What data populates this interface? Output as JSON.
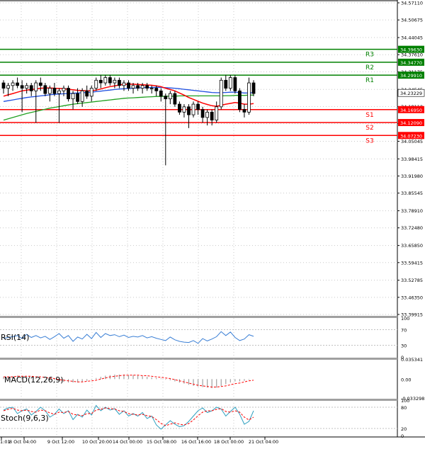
{
  "chart_data": {
    "type": "candlestick",
    "price_axis_labels": [
      "34.57110",
      "34.50675",
      "34.44045",
      "34.37610",
      "34.31175",
      "34.24545",
      "34.18110",
      "34.11675",
      "34.05045",
      "33.98415",
      "33.91980",
      "33.85545",
      "33.78910",
      "33.72480",
      "33.65850",
      "33.59415",
      "33.52785",
      "33.46350",
      "33.39915"
    ],
    "ylim": [
      33.39915,
      34.5711
    ],
    "x_labels": [
      "1:01",
      "8 Oct 04:00",
      "9 Oct 12:00",
      "10 Oct 20:00",
      "14 Oct 00:00",
      "15 Oct 08:00",
      "16 Oct 16:00",
      "18 Oct 00:00",
      "21 Oct 04:00"
    ],
    "current_price": {
      "value": 34.23229,
      "label": "34.23229"
    },
    "levels": [
      {
        "name": "R3",
        "value": 34.3963,
        "label": "34.39630",
        "color": "#008000"
      },
      {
        "name": "R2",
        "value": 34.3477,
        "label": "34.34770",
        "color": "#008000"
      },
      {
        "name": "R1",
        "value": 34.2991,
        "label": "34.29910",
        "color": "#008000"
      },
      {
        "name": "S1",
        "value": 34.1695,
        "label": "34.16950",
        "color": "#ff0000"
      },
      {
        "name": "S2",
        "value": 34.1209,
        "label": "34.12090",
        "color": "#ff0000"
      },
      {
        "name": "S3",
        "value": 34.0723,
        "label": "34.07230",
        "color": "#ff0000"
      }
    ],
    "candles": [
      {
        "o": 34.27,
        "h": 34.28,
        "l": 34.23,
        "c": 34.25
      },
      {
        "o": 34.25,
        "h": 34.27,
        "l": 34.22,
        "c": 34.26
      },
      {
        "o": 34.26,
        "h": 34.28,
        "l": 34.24,
        "c": 34.27
      },
      {
        "o": 34.27,
        "h": 34.29,
        "l": 34.25,
        "c": 34.26
      },
      {
        "o": 34.26,
        "h": 34.28,
        "l": 34.16,
        "c": 34.25
      },
      {
        "o": 34.25,
        "h": 34.27,
        "l": 34.23,
        "c": 34.26
      },
      {
        "o": 34.26,
        "h": 34.27,
        "l": 34.22,
        "c": 34.24
      },
      {
        "o": 34.24,
        "h": 34.28,
        "l": 34.12,
        "c": 34.27
      },
      {
        "o": 34.27,
        "h": 34.29,
        "l": 34.24,
        "c": 34.26
      },
      {
        "o": 34.26,
        "h": 34.27,
        "l": 34.22,
        "c": 34.23
      },
      {
        "o": 34.23,
        "h": 34.26,
        "l": 34.2,
        "c": 34.25
      },
      {
        "o": 34.25,
        "h": 34.27,
        "l": 34.22,
        "c": 34.23
      },
      {
        "o": 34.23,
        "h": 34.25,
        "l": 34.12,
        "c": 34.24
      },
      {
        "o": 34.24,
        "h": 34.26,
        "l": 34.22,
        "c": 34.25
      },
      {
        "o": 34.25,
        "h": 34.26,
        "l": 34.2,
        "c": 34.21
      },
      {
        "o": 34.21,
        "h": 34.24,
        "l": 34.17,
        "c": 34.23
      },
      {
        "o": 34.23,
        "h": 34.25,
        "l": 34.19,
        "c": 34.2
      },
      {
        "o": 34.2,
        "h": 34.25,
        "l": 34.18,
        "c": 34.24
      },
      {
        "o": 34.24,
        "h": 34.26,
        "l": 34.21,
        "c": 34.22
      },
      {
        "o": 34.22,
        "h": 34.26,
        "l": 34.2,
        "c": 34.25
      },
      {
        "o": 34.25,
        "h": 34.29,
        "l": 34.24,
        "c": 34.28
      },
      {
        "o": 34.28,
        "h": 34.3,
        "l": 34.25,
        "c": 34.27
      },
      {
        "o": 34.27,
        "h": 34.3,
        "l": 34.26,
        "c": 34.29
      },
      {
        "o": 34.29,
        "h": 34.3,
        "l": 34.26,
        "c": 34.27
      },
      {
        "o": 34.27,
        "h": 34.29,
        "l": 34.25,
        "c": 34.28
      },
      {
        "o": 34.28,
        "h": 34.29,
        "l": 34.25,
        "c": 34.26
      },
      {
        "o": 34.26,
        "h": 34.28,
        "l": 34.24,
        "c": 34.27
      },
      {
        "o": 34.27,
        "h": 34.28,
        "l": 34.24,
        "c": 34.25
      },
      {
        "o": 34.25,
        "h": 34.27,
        "l": 34.23,
        "c": 34.26
      },
      {
        "o": 34.26,
        "h": 34.27,
        "l": 34.24,
        "c": 34.25
      },
      {
        "o": 34.25,
        "h": 34.27,
        "l": 34.23,
        "c": 34.26
      },
      {
        "o": 34.26,
        "h": 34.27,
        "l": 34.24,
        "c": 34.25
      },
      {
        "o": 34.25,
        "h": 34.26,
        "l": 34.23,
        "c": 34.25
      },
      {
        "o": 34.25,
        "h": 34.26,
        "l": 34.22,
        "c": 34.24
      },
      {
        "o": 34.24,
        "h": 34.25,
        "l": 34.2,
        "c": 34.22
      },
      {
        "o": 34.22,
        "h": 34.23,
        "l": 33.96,
        "c": 34.21
      },
      {
        "o": 34.21,
        "h": 34.24,
        "l": 34.19,
        "c": 34.23
      },
      {
        "o": 34.23,
        "h": 34.24,
        "l": 34.18,
        "c": 34.19
      },
      {
        "o": 34.19,
        "h": 34.2,
        "l": 34.15,
        "c": 34.16
      },
      {
        "o": 34.16,
        "h": 34.19,
        "l": 34.14,
        "c": 34.18
      },
      {
        "o": 34.18,
        "h": 34.19,
        "l": 34.1,
        "c": 34.15
      },
      {
        "o": 34.15,
        "h": 34.2,
        "l": 34.14,
        "c": 34.19
      },
      {
        "o": 34.19,
        "h": 34.2,
        "l": 34.15,
        "c": 34.17
      },
      {
        "o": 34.17,
        "h": 34.18,
        "l": 34.12,
        "c": 34.14
      },
      {
        "o": 34.14,
        "h": 34.17,
        "l": 34.11,
        "c": 34.16
      },
      {
        "o": 34.16,
        "h": 34.17,
        "l": 34.11,
        "c": 34.13
      },
      {
        "o": 34.13,
        "h": 34.2,
        "l": 34.12,
        "c": 34.18
      },
      {
        "o": 34.18,
        "h": 34.29,
        "l": 34.17,
        "c": 34.28
      },
      {
        "o": 34.28,
        "h": 34.3,
        "l": 34.24,
        "c": 34.25
      },
      {
        "o": 34.25,
        "h": 34.3,
        "l": 34.24,
        "c": 34.29
      },
      {
        "o": 34.29,
        "h": 34.3,
        "l": 34.23,
        "c": 34.24
      },
      {
        "o": 34.24,
        "h": 34.25,
        "l": 34.16,
        "c": 34.17
      },
      {
        "o": 34.17,
        "h": 34.19,
        "l": 34.14,
        "c": 34.16
      },
      {
        "o": 34.16,
        "h": 34.29,
        "l": 34.15,
        "c": 34.27
      },
      {
        "o": 34.27,
        "h": 34.28,
        "l": 34.22,
        "c": 34.23
      }
    ],
    "ma_red": {
      "color": "#ff0000",
      "values": [
        34.22,
        34.225,
        34.23,
        34.235,
        34.24,
        34.243,
        34.245,
        34.247,
        34.25,
        34.251,
        34.251,
        34.25,
        34.249,
        34.248,
        34.246,
        34.244,
        34.242,
        34.241,
        34.24,
        34.24,
        34.243,
        34.247,
        34.252,
        34.256,
        34.259,
        34.262,
        34.264,
        34.265,
        34.265,
        34.264,
        34.263,
        34.262,
        34.261,
        34.259,
        34.256,
        34.25,
        34.245,
        34.24,
        34.232,
        34.224,
        34.215,
        34.208,
        34.201,
        34.194,
        34.189,
        34.184,
        34.182,
        34.186,
        34.19,
        34.193,
        34.196,
        34.194,
        34.19,
        34.19,
        34.192
      ]
    },
    "ma_blue": {
      "color": "#2050e0",
      "values": [
        34.2,
        34.203,
        34.206,
        34.209,
        34.212,
        34.215,
        34.217,
        34.219,
        34.221,
        34.223,
        34.225,
        34.227,
        34.228,
        34.229,
        34.23,
        34.231,
        34.232,
        34.233,
        34.234,
        34.235,
        34.237,
        34.239,
        34.241,
        34.243,
        34.245,
        34.247,
        34.248,
        34.249,
        34.25,
        34.251,
        34.252,
        34.252,
        34.253,
        34.253,
        34.253,
        34.252,
        34.251,
        34.25,
        34.248,
        34.246,
        34.244,
        34.242,
        34.24,
        34.238,
        34.236,
        34.234,
        34.233,
        34.233,
        34.234,
        34.235,
        34.235,
        34.234,
        34.232,
        34.232,
        34.233
      ]
    },
    "ma_green": {
      "color": "#20a020",
      "values": [
        34.13,
        34.135,
        34.14,
        34.145,
        34.15,
        34.155,
        34.159,
        34.163,
        34.167,
        34.171,
        34.175,
        34.178,
        34.181,
        34.184,
        34.187,
        34.19,
        34.192,
        34.194,
        34.196,
        34.198,
        34.2,
        34.202,
        34.204,
        34.206,
        34.208,
        34.21,
        34.212,
        34.213,
        34.214,
        34.215,
        34.216,
        34.217,
        34.218,
        34.219,
        34.219,
        34.22,
        34.22,
        34.22,
        34.221,
        34.221,
        34.221,
        34.221,
        34.221,
        34.221,
        34.221,
        34.221,
        34.221,
        34.221,
        34.222,
        34.222,
        34.223,
        34.223,
        34.223,
        34.224,
        34.224
      ]
    },
    "rsi": {
      "label": "RSI(14)",
      "ticks": [
        "100",
        "70",
        "30",
        "0"
      ],
      "levels": [
        70,
        30
      ],
      "color": "#3a7fd5",
      "values": [
        48,
        50,
        52,
        55,
        47,
        58,
        50,
        55,
        49,
        53,
        45,
        52,
        60,
        48,
        55,
        40,
        51,
        46,
        58,
        47,
        63,
        50,
        60,
        55,
        57,
        52,
        56,
        50,
        53,
        51,
        55,
        49,
        52,
        48,
        45,
        42,
        51,
        44,
        40,
        38,
        37,
        42,
        35,
        47,
        41,
        46,
        52,
        65,
        55,
        64,
        50,
        42,
        46,
        57,
        53
      ]
    },
    "macd": {
      "label": "MACD(12,26,9)",
      "ticks": [
        "0.035341",
        "0.00",
        "-0.033298"
      ],
      "ylim": [
        -0.033298,
        0.035341
      ],
      "hist_color": "#a0a0a0",
      "signal_color": "#ff0000",
      "hist": [
        0.004,
        0.004,
        0.005,
        0.006,
        0.005,
        0.005,
        0.004,
        0.003,
        0.002,
        0.001,
        0.0,
        -0.002,
        -0.004,
        -0.005,
        -0.006,
        -0.006,
        -0.006,
        -0.005,
        -0.003,
        -0.001,
        0.002,
        0.004,
        0.006,
        0.007,
        0.008,
        0.008,
        0.008,
        0.007,
        0.007,
        0.006,
        0.005,
        0.004,
        0.003,
        0.002,
        0.001,
        -0.001,
        -0.002,
        -0.004,
        -0.006,
        -0.008,
        -0.01,
        -0.012,
        -0.013,
        -0.014,
        -0.015,
        -0.016,
        -0.015,
        -0.012,
        -0.009,
        -0.006,
        -0.004,
        -0.004,
        -0.003,
        -0.001,
        0.0
      ],
      "signal": [
        0.004,
        0.004,
        0.004,
        0.005,
        0.005,
        0.005,
        0.005,
        0.004,
        0.004,
        0.003,
        0.002,
        0.001,
        -0.001,
        -0.002,
        -0.003,
        -0.004,
        -0.005,
        -0.005,
        -0.004,
        -0.003,
        -0.002,
        0.0,
        0.002,
        0.004,
        0.005,
        0.006,
        0.007,
        0.007,
        0.007,
        0.007,
        0.006,
        0.006,
        0.005,
        0.004,
        0.003,
        0.002,
        0.001,
        -0.001,
        -0.003,
        -0.005,
        -0.007,
        -0.009,
        -0.011,
        -0.012,
        -0.013,
        -0.014,
        -0.014,
        -0.013,
        -0.012,
        -0.01,
        -0.008,
        -0.007,
        -0.005,
        -0.003,
        -0.002
      ]
    },
    "stoch": {
      "label": "Stoch(9,6,3)",
      "ticks": [
        "100",
        "80",
        "20",
        "0"
      ],
      "levels": [
        80,
        20
      ],
      "k_color": "#2fa0c0",
      "d_color": "#ff0000",
      "k": [
        72,
        78,
        80,
        62,
        70,
        75,
        58,
        68,
        80,
        70,
        52,
        60,
        75,
        62,
        70,
        45,
        60,
        52,
        72,
        58,
        85,
        70,
        80,
        72,
        76,
        60,
        70,
        55,
        62,
        55,
        65,
        48,
        55,
        30,
        18,
        30,
        42,
        32,
        25,
        28,
        40,
        55,
        70,
        78,
        65,
        70,
        80,
        75,
        55,
        68,
        80,
        60,
        32,
        40,
        70
      ],
      "d": [
        70,
        74,
        77,
        72,
        70,
        72,
        68,
        66,
        72,
        70,
        64,
        60,
        66,
        65,
        68,
        60,
        58,
        56,
        62,
        62,
        72,
        74,
        78,
        76,
        75,
        70,
        68,
        62,
        60,
        58,
        60,
        56,
        54,
        45,
        34,
        28,
        32,
        36,
        32,
        30,
        34,
        44,
        56,
        66,
        70,
        70,
        74,
        76,
        68,
        66,
        70,
        66,
        52,
        44,
        52
      ]
    }
  }
}
